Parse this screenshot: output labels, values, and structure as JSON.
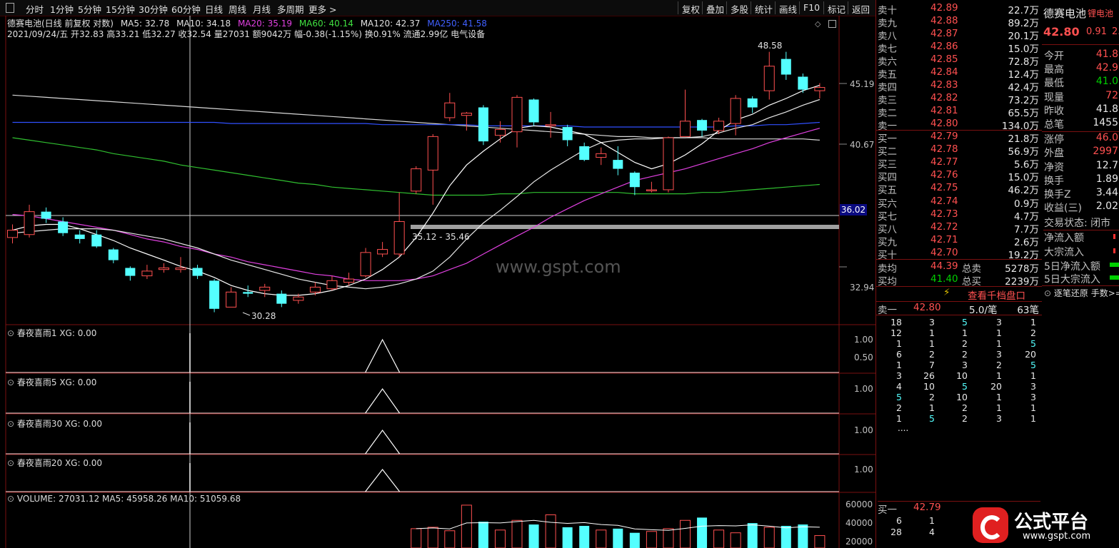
{
  "toolbar": {
    "periods": [
      "分时",
      "1分钟",
      "5分钟",
      "15分钟",
      "30分钟",
      "60分钟",
      "日线",
      "周线",
      "月线",
      "多周期",
      "更多 >"
    ],
    "right": [
      "复权",
      "叠加",
      "多股",
      "统计",
      "画线",
      "F10",
      "标记",
      "返回"
    ]
  },
  "chart_header": {
    "line1_name": "德赛电池(日线 前复权 对数)",
    "ma5": "MA5: 32.78",
    "ma10": "MA10: 34.18",
    "ma20": "MA20: 35.19",
    "ma60": "MA60: 40.14",
    "ma120": "MA120: 42.37",
    "ma250": "MA250: 41.58",
    "line2": "2021/09/24/五 开32.83 高33.21 低32.27 收32.54 量27031 额9042万 幅-0.38(-1.15%) 换0.91% 流通2.99亿 电气设备"
  },
  "price_axis": [
    "45.19",
    "40.67",
    "36.02",
    "32.94"
  ],
  "annotations": {
    "high": "48.58",
    "low": "30.28",
    "range": "35.12 - 35.46",
    "watermark": "www.gspt.com"
  },
  "subcharts": [
    {
      "title": "春夜喜雨1 XG: 0.00",
      "ticks": [
        "1.00",
        "0.50"
      ]
    },
    {
      "title": "春夜喜雨5 XG: 0.00",
      "ticks": [
        "1.00"
      ]
    },
    {
      "title": "春夜喜雨30 XG: 0.00",
      "ticks": [
        "1.00"
      ]
    },
    {
      "title": "春夜喜雨20 XG: 0.00",
      "ticks": [
        "1.00"
      ]
    }
  ],
  "volume": {
    "title": "VOLUME: 27031.12 MA5: 45958.26 MA10: 51059.68",
    "ticks": [
      "60000",
      "40000",
      "20000"
    ]
  },
  "chart_data": {
    "type": "candlestick",
    "candles": [
      {
        "o": 33.3,
        "c": 33.8,
        "h": 34.2,
        "l": 32.9
      },
      {
        "o": 33.5,
        "c": 35.1,
        "h": 35.6,
        "l": 33.3
      },
      {
        "o": 35.1,
        "c": 34.6,
        "h": 35.4,
        "l": 34.3
      },
      {
        "o": 34.4,
        "c": 33.6,
        "h": 34.7,
        "l": 33.4
      },
      {
        "o": 33.5,
        "c": 33.2,
        "h": 33.8,
        "l": 32.9
      },
      {
        "o": 33.5,
        "c": 32.7,
        "h": 33.8,
        "l": 32.6
      },
      {
        "o": 32.5,
        "c": 31.8,
        "h": 32.6,
        "l": 31.6
      },
      {
        "o": 31.3,
        "c": 30.8,
        "h": 31.4,
        "l": 30.5
      },
      {
        "o": 30.8,
        "c": 31.1,
        "h": 31.5,
        "l": 30.6
      },
      {
        "o": 31.2,
        "c": 31.3,
        "h": 31.6,
        "l": 31.0
      },
      {
        "o": 31.2,
        "c": 31.3,
        "h": 32.0,
        "l": 31.0
      },
      {
        "o": 31.3,
        "c": 30.8,
        "h": 31.5,
        "l": 30.6
      },
      {
        "o": 30.5,
        "c": 28.8,
        "h": 30.6,
        "l": 28.6
      },
      {
        "o": 28.9,
        "c": 29.8,
        "h": 30.1,
        "l": 28.9
      },
      {
        "o": 29.8,
        "c": 29.7,
        "h": 30.2,
        "l": 29.5
      },
      {
        "o": 29.9,
        "c": 30.1,
        "h": 30.3,
        "l": 29.5
      },
      {
        "o": 29.7,
        "c": 29.1,
        "h": 29.9,
        "l": 28.9
      },
      {
        "o": 29.3,
        "c": 29.5,
        "h": 29.7,
        "l": 29.1
      },
      {
        "o": 29.8,
        "c": 30.1,
        "h": 30.4,
        "l": 29.6
      },
      {
        "o": 30.0,
        "c": 30.5,
        "h": 30.8,
        "l": 29.9
      },
      {
        "o": 30.4,
        "c": 30.6,
        "h": 31.0,
        "l": 30.2
      },
      {
        "o": 30.8,
        "c": 32.3,
        "h": 32.6,
        "l": 30.7
      },
      {
        "o": 32.2,
        "c": 32.5,
        "h": 33.0,
        "l": 32.0
      },
      {
        "o": 32.2,
        "c": 34.4,
        "h": 36.5,
        "l": 32.0
      },
      {
        "o": 36.6,
        "c": 38.3,
        "h": 38.5,
        "l": 36.4
      },
      {
        "o": 38.2,
        "c": 40.9,
        "h": 41.1,
        "l": 35.6
      },
      {
        "o": 42.5,
        "c": 43.8,
        "h": 44.7,
        "l": 42.2
      },
      {
        "o": 42.7,
        "c": 42.9,
        "h": 43.0,
        "l": 41.4
      },
      {
        "o": 43.4,
        "c": 40.5,
        "h": 43.6,
        "l": 40.2
      },
      {
        "o": 41.0,
        "c": 41.5,
        "h": 42.2,
        "l": 40.4
      },
      {
        "o": 41.3,
        "c": 44.3,
        "h": 44.5,
        "l": 40.0
      },
      {
        "o": 44.1,
        "c": 42.1,
        "h": 44.2,
        "l": 41.8
      },
      {
        "o": 41.8,
        "c": 41.9,
        "h": 43.0,
        "l": 40.8
      },
      {
        "o": 41.7,
        "c": 40.6,
        "h": 41.9,
        "l": 40.1
      },
      {
        "o": 40.1,
        "c": 39.0,
        "h": 40.4,
        "l": 38.9
      },
      {
        "o": 39.2,
        "c": 39.5,
        "h": 40.0,
        "l": 38.6
      },
      {
        "o": 39.0,
        "c": 38.3,
        "h": 40.1,
        "l": 37.8
      },
      {
        "o": 38.0,
        "c": 36.9,
        "h": 38.1,
        "l": 36.3
      },
      {
        "o": 36.7,
        "c": 36.7,
        "h": 37.3,
        "l": 36.5
      },
      {
        "o": 36.7,
        "c": 40.8,
        "h": 40.9,
        "l": 36.5
      },
      {
        "o": 40.9,
        "c": 42.2,
        "h": 45.0,
        "l": 40.9
      },
      {
        "o": 42.3,
        "c": 41.4,
        "h": 42.4,
        "l": 40.9
      },
      {
        "o": 41.4,
        "c": 42.2,
        "h": 42.5,
        "l": 41.1
      },
      {
        "o": 42.0,
        "c": 44.2,
        "h": 44.5,
        "l": 41.0
      },
      {
        "o": 44.2,
        "c": 43.4,
        "h": 44.4,
        "l": 42.9
      },
      {
        "o": 44.9,
        "c": 47.2,
        "h": 48.6,
        "l": 44.1
      },
      {
        "o": 47.9,
        "c": 46.4,
        "h": 48.6,
        "l": 45.9
      },
      {
        "o": 46.2,
        "c": 45.0,
        "h": 46.5,
        "l": 44.7
      },
      {
        "o": 44.9,
        "c": 45.2,
        "h": 45.6,
        "l": 44.2
      }
    ],
    "ma5": [
      33.8,
      34.1,
      34.2,
      34.2,
      33.9,
      33.5,
      33.1,
      32.6,
      32.2,
      31.8,
      31.4,
      31.1,
      30.7,
      30.2,
      29.9,
      29.7,
      29.6,
      29.6,
      29.7,
      29.9,
      30.2,
      30.6,
      31.2,
      32.0,
      33.3,
      35.0,
      37.0,
      38.6,
      39.7,
      40.7,
      41.6,
      41.8,
      41.7,
      41.4,
      41.1,
      40.4,
      39.6,
      38.8,
      38.3,
      38.7,
      39.4,
      40.3,
      41.4,
      42.3,
      42.8,
      43.6,
      44.2,
      44.9,
      45.4
    ],
    "ma10": [
      33.6,
      33.7,
      33.8,
      33.9,
      33.9,
      33.9,
      33.8,
      33.6,
      33.4,
      33.2,
      32.9,
      32.6,
      32.2,
      31.8,
      31.5,
      31.2,
      30.9,
      30.6,
      30.4,
      30.2,
      30.1,
      30.0,
      30.1,
      30.3,
      30.6,
      31.1,
      32.0,
      33.2,
      34.3,
      35.2,
      36.2,
      37.3,
      38.2,
      39.0,
      39.8,
      40.4,
      40.6,
      40.7,
      40.7,
      40.8,
      40.8,
      40.9,
      41.2,
      41.6,
      41.9,
      42.5,
      43.0,
      43.6,
      44.1
    ],
    "ma20": [
      34.9,
      34.8,
      34.6,
      34.4,
      34.2,
      34.0,
      33.8,
      33.5,
      33.2,
      33.0,
      32.7,
      32.5,
      32.2,
      32.0,
      31.7,
      31.5,
      31.3,
      31.1,
      30.9,
      30.8,
      30.6,
      30.5,
      30.5,
      30.5,
      30.6,
      30.8,
      31.2,
      31.6,
      32.2,
      32.8,
      33.4,
      34.0,
      34.7,
      35.3,
      35.9,
      36.4,
      36.9,
      37.4,
      37.7,
      38.0,
      38.3,
      38.7,
      39.1,
      39.5,
      39.9,
      40.4,
      40.8,
      41.2,
      41.6
    ],
    "ma60": [
      40.8,
      40.6,
      40.4,
      40.2,
      40.0,
      39.8,
      39.5,
      39.3,
      39.1,
      38.9,
      38.6,
      38.4,
      38.2,
      38.0,
      37.8,
      37.6,
      37.4,
      37.2,
      37.1,
      36.9,
      36.8,
      36.7,
      36.6,
      36.5,
      36.4,
      36.3,
      36.3,
      36.3,
      36.3,
      36.4,
      36.4,
      36.5,
      36.5,
      36.5,
      36.5,
      36.5,
      36.5,
      36.4,
      36.4,
      36.4,
      36.4,
      36.5,
      36.5,
      36.6,
      36.7,
      36.8,
      36.9,
      37.0,
      37.1
    ],
    "ma120": [
      44.5,
      44.4,
      44.3,
      44.2,
      44.1,
      44.0,
      43.9,
      43.8,
      43.7,
      43.6,
      43.5,
      43.4,
      43.3,
      43.2,
      43.1,
      43.0,
      42.9,
      42.8,
      42.7,
      42.6,
      42.5,
      42.4,
      42.3,
      42.2,
      42.1,
      42.0,
      41.9,
      41.8,
      41.7,
      41.6,
      41.5,
      41.4,
      41.3,
      41.2,
      41.1,
      41.0,
      40.9,
      40.9,
      40.8,
      40.8,
      40.8,
      40.8,
      40.7,
      40.7,
      40.7,
      40.7,
      40.7,
      40.7,
      40.6
    ],
    "ma250": [
      42.1,
      42.1,
      42.1,
      42.1,
      42.1,
      42.1,
      42.1,
      42.1,
      42.1,
      42.1,
      42.1,
      42.1,
      42.1,
      42.0,
      42.0,
      42.0,
      42.0,
      42.0,
      42.0,
      42.0,
      42.0,
      42.0,
      41.9,
      41.9,
      41.9,
      41.9,
      41.9,
      41.9,
      41.8,
      41.8,
      41.8,
      41.8,
      41.8,
      41.8,
      41.7,
      41.7,
      41.7,
      41.7,
      41.7,
      41.7,
      41.7,
      41.7,
      41.7,
      41.8,
      41.8,
      41.9,
      41.9,
      42.0,
      42.1
    ],
    "volume": [
      null,
      null,
      null,
      null,
      null,
      null,
      null,
      null,
      null,
      null,
      null,
      null,
      null,
      null,
      null,
      null,
      null,
      null,
      null,
      null,
      null,
      null,
      null,
      null,
      28000,
      30000,
      25000,
      62000,
      38000,
      26000,
      40000,
      34000,
      48000,
      30000,
      32000,
      26000,
      28000,
      22000,
      24000,
      28000,
      40000,
      44000,
      26000,
      22000,
      36000,
      30000,
      32000,
      34000,
      18000
    ],
    "signal_peak_index": 22
  },
  "orderbook": {
    "asks": [
      {
        "label": "卖十",
        "price": "42.89",
        "vol": "22.7万"
      },
      {
        "label": "卖九",
        "price": "42.88",
        "vol": "89.2万"
      },
      {
        "label": "卖八",
        "price": "42.87",
        "vol": "20.1万"
      },
      {
        "label": "卖七",
        "price": "42.86",
        "vol": "15.0万"
      },
      {
        "label": "卖六",
        "price": "42.85",
        "vol": "72.8万"
      },
      {
        "label": "卖五",
        "price": "42.84",
        "vol": "12.4万"
      },
      {
        "label": "卖四",
        "price": "42.83",
        "vol": "42.4万"
      },
      {
        "label": "卖三",
        "price": "42.82",
        "vol": "73.2万"
      },
      {
        "label": "卖二",
        "price": "42.81",
        "vol": "65.5万"
      },
      {
        "label": "卖一",
        "price": "42.80",
        "vol": "134.0万"
      }
    ],
    "bids": [
      {
        "label": "买一",
        "price": "42.79",
        "vol": "21.8万"
      },
      {
        "label": "买二",
        "price": "42.78",
        "vol": "56.9万"
      },
      {
        "label": "买三",
        "price": "42.77",
        "vol": "5.6万"
      },
      {
        "label": "买四",
        "price": "42.76",
        "vol": "15.0万"
      },
      {
        "label": "买五",
        "price": "42.75",
        "vol": "46.2万"
      },
      {
        "label": "买六",
        "price": "42.74",
        "vol": "0.9万"
      },
      {
        "label": "买七",
        "price": "42.73",
        "vol": "4.7万"
      },
      {
        "label": "买八",
        "price": "42.72",
        "vol": "7.7万"
      },
      {
        "label": "买九",
        "price": "42.71",
        "vol": "2.6万"
      },
      {
        "label": "买十",
        "price": "42.70",
        "vol": "19.2万"
      }
    ],
    "ask_avg_label": "卖均",
    "ask_avg": "44.39",
    "ask_total_label": "总卖",
    "ask_total": "5278万",
    "bid_avg_label": "买均",
    "bid_avg": "41.40",
    "bid_total_label": "总买",
    "bid_total": "2239万",
    "depth_link": "查看千档盘口",
    "queue_label": "卖一",
    "queue_price": "42.80",
    "queue_avg": "5.0/笔",
    "queue_count": "63笔",
    "queue_rows": [
      [
        "18",
        "3",
        "5",
        "3",
        "1"
      ],
      [
        "12",
        "1",
        "1",
        "1",
        "2"
      ],
      [
        "1",
        "1",
        "2",
        "1",
        "5"
      ],
      [
        "6",
        "2",
        "2",
        "3",
        "20"
      ],
      [
        "1",
        "7",
        "3",
        "2",
        "5"
      ],
      [
        "3",
        "26",
        "10",
        "1",
        "1"
      ],
      [
        "4",
        "10",
        "5",
        "20",
        "3"
      ],
      [
        "5",
        "2",
        "10",
        "1",
        "3"
      ],
      [
        "2",
        "1",
        "2",
        "1",
        "1"
      ],
      [
        "1",
        "5",
        "2",
        "3",
        "1"
      ]
    ],
    "queue_more": "....",
    "bottom_label": "买一",
    "bottom_price": "42.79",
    "bottom_rows": [
      [
        "6",
        "1",
        "1",
        "1",
        "1"
      ],
      [
        "28",
        "4",
        "1",
        "1",
        "1"
      ]
    ]
  },
  "stockinfo": {
    "name": "德赛电池",
    "sector": "锂电池",
    "price": "42.80",
    "change": "0.91",
    "change_pct": "2.",
    "rows": [
      {
        "k": "今开",
        "v": "41.8"
      },
      {
        "k": "最高",
        "v": "42.9"
      },
      {
        "k": "最低",
        "v": "41.0"
      },
      {
        "k": "现量",
        "v": "72"
      },
      {
        "k": "昨收",
        "v": "41.8"
      },
      {
        "k": "总笔",
        "v": "1455"
      },
      {
        "k": "涨停",
        "v": "46.0"
      },
      {
        "k": "外盘",
        "v": "2997"
      },
      {
        "k": "净资",
        "v": "12.7"
      },
      {
        "k": "换手",
        "v": "1.89"
      },
      {
        "k": "换手Z",
        "v": "3.44"
      },
      {
        "k": "收益(三)",
        "v": "2.02"
      }
    ],
    "status": "交易状态: 闭市",
    "flows": [
      "净流入额",
      "大宗流入",
      "5日净流入额",
      "5日大宗流入"
    ],
    "tabs": "逐笔还原  手数>="
  },
  "logo_text": "公式平台",
  "logo_url": "www.gspt.com",
  "colors": {
    "up": "#ff5050",
    "down": "#54ffff",
    "bg": "#000000"
  }
}
